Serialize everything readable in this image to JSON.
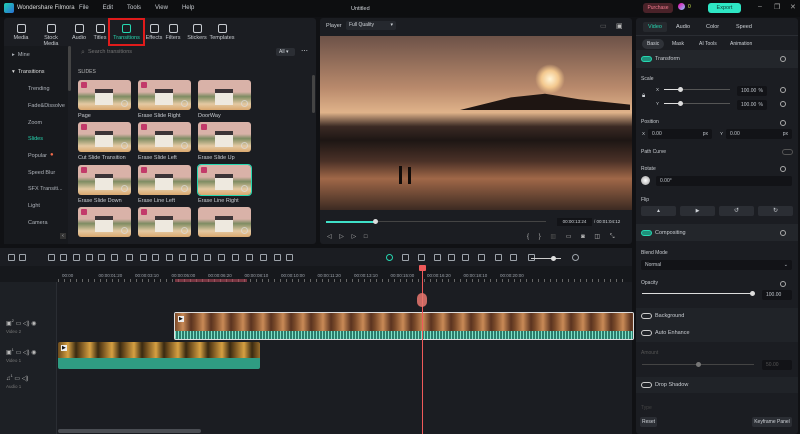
{
  "app": {
    "title": "Wondershare Filmora",
    "project": "Untitled",
    "menu": [
      "File",
      "Edit",
      "Tools",
      "View",
      "Help"
    ],
    "purchase": "Purchase",
    "points": "0",
    "export": "Export"
  },
  "media_tabs": [
    {
      "label": "Media"
    },
    {
      "label": "Stock Media"
    },
    {
      "label": "Audio"
    },
    {
      "label": "Titles"
    },
    {
      "label": "Transitions",
      "active": true
    },
    {
      "label": "Effects"
    },
    {
      "label": "Filters"
    },
    {
      "label": "Stickers"
    },
    {
      "label": "Templates"
    }
  ],
  "sidebar": {
    "mine": "Mine",
    "transitions": "Transitions",
    "items": [
      "Trending",
      "Fade&Dissolve",
      "Zoom",
      "Slides",
      "Popular",
      "Speed Blur",
      "SFX Transiti...",
      "Light",
      "Camera"
    ],
    "active": "Slides"
  },
  "search": {
    "placeholder": "Search transitions",
    "filter": "All"
  },
  "section": "SLIDES",
  "transitions": [
    "Page",
    "Erase Slide Right",
    "DoorWay",
    "Cut Slide Transition",
    "Erase Slide Left",
    "Erase Slide Up",
    "Erase Slide Down",
    "Erase Line Left",
    "Erase Line Right",
    "",
    "",
    ""
  ],
  "player": {
    "label": "Player",
    "quality": "Full Quality",
    "current": "00:00:13:24",
    "total": "/ 00:01:04:12",
    "progress": 0.2
  },
  "right": {
    "tabs": [
      "Video",
      "Audio",
      "Color",
      "Speed"
    ],
    "subtabs": [
      "Basic",
      "Mask",
      "AI Tools",
      "Animation"
    ],
    "transform": "Transform",
    "scale": "Scale",
    "scale_x": "100.00",
    "scale_y": "100.00",
    "pct": "%",
    "x": "X",
    "y": "Y",
    "position": "Position",
    "pos_x": "0.00",
    "pos_y": "0.00",
    "px": "px",
    "path_curve": "Path Curve",
    "rotate": "Rotate",
    "rotate_val": "0.00°",
    "flip": "Flip",
    "compositing": "Compositing",
    "blend_mode": "Blend Mode",
    "blend_val": "Normal",
    "opacity": "Opacity",
    "opacity_val": "100.00",
    "background": "Background",
    "auto_enhance": "Auto Enhance",
    "amount": "Amount",
    "amount_val": "50.00",
    "drop_shadow": "Drop Shadow",
    "type": "Type",
    "reset": "Reset",
    "keyframe": "Keyframe Panel"
  },
  "timeline": {
    "ticks": [
      "00:00",
      "00:00:01:20",
      "00:00:03:10",
      "00:00:05:00",
      "00:00:06:20",
      "00:00:08:10",
      "00:00:10:00",
      "00:00:11:20",
      "00:00:13:10",
      "00:00:15:00",
      "00:00:16:20",
      "00:00:18:10",
      "00:00:20:00"
    ],
    "tracks": [
      "Video 2",
      "Video 1",
      "Audio 1"
    ],
    "track_nums": [
      "2",
      "1",
      "1"
    ]
  }
}
